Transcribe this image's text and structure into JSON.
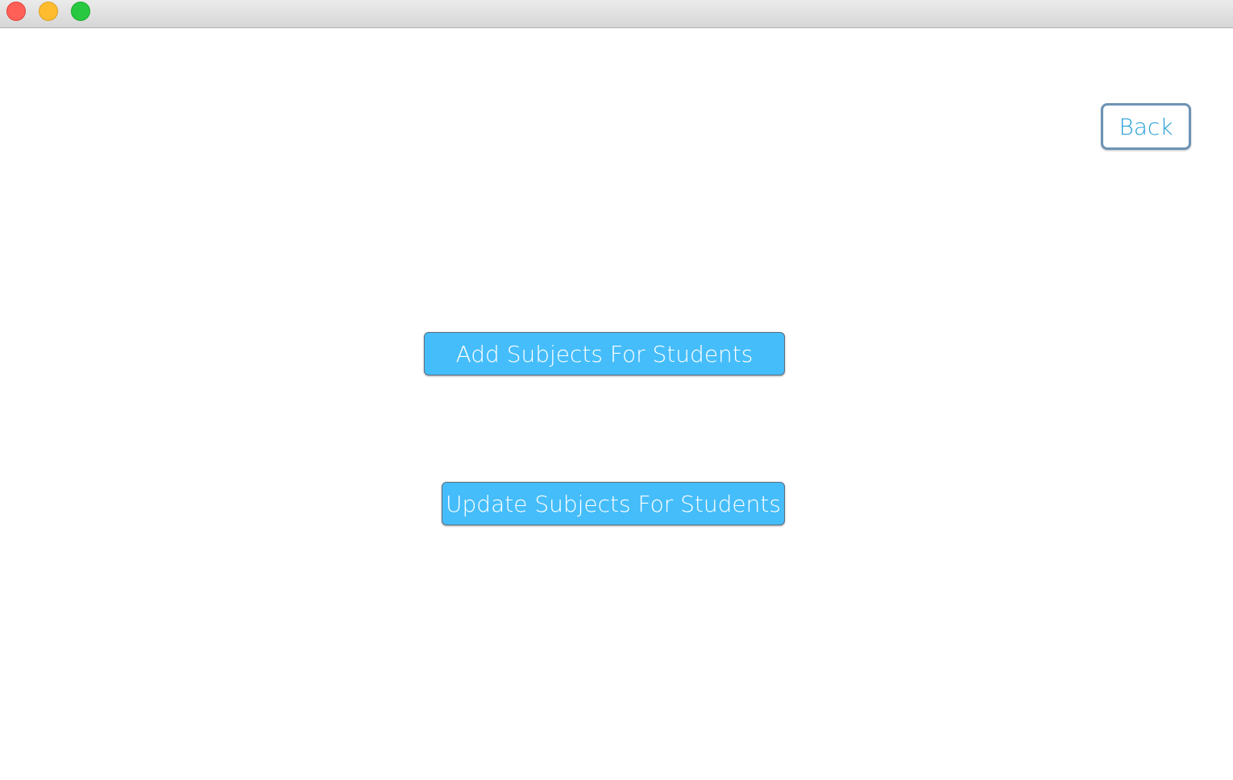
{
  "window": {
    "controls": {
      "close_icon": "close-traffic-light",
      "minimize_icon": "minimize-traffic-light",
      "zoom_icon": "zoom-traffic-light"
    }
  },
  "header": {
    "back_label": "Back"
  },
  "main": {
    "add_subjects_label": "Add Subjects For Students",
    "update_subjects_label": "Update Subjects For Students"
  },
  "colors": {
    "accent": "#45bdfa",
    "back_text": "#2a9fd6",
    "back_border": "#6e93b5"
  }
}
